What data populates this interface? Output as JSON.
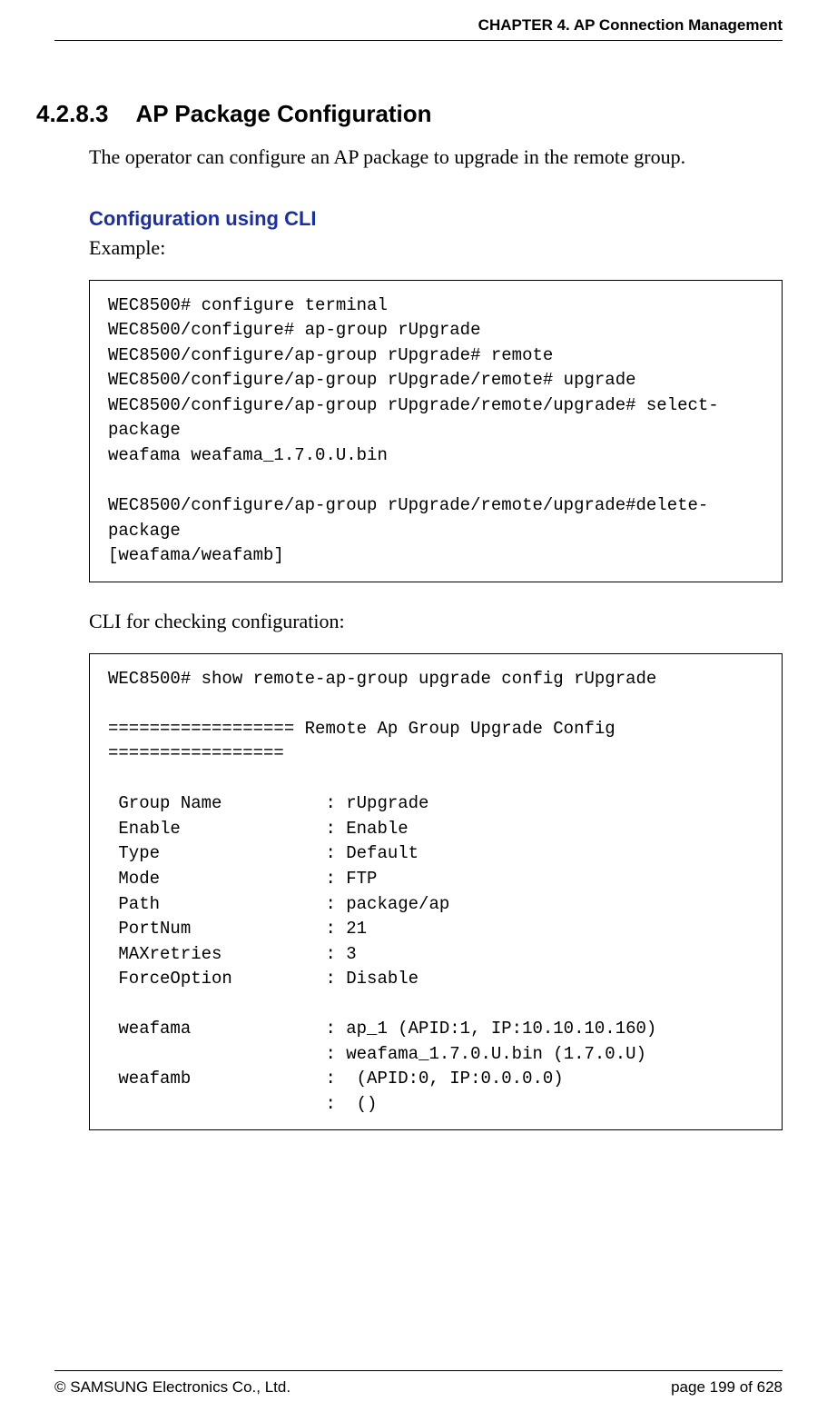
{
  "header": {
    "chapter": "CHAPTER 4. AP Connection Management"
  },
  "section": {
    "number": "4.2.8.3",
    "title": "AP Package Configuration",
    "intro": "The operator can configure an AP package to upgrade in the remote group."
  },
  "cli": {
    "heading": "Configuration using CLI",
    "example_label": "Example:",
    "code1": "WEC8500# configure terminal\nWEC8500/configure# ap-group rUpgrade\nWEC8500/configure/ap-group rUpgrade# remote\nWEC8500/configure/ap-group rUpgrade/remote# upgrade\nWEC8500/configure/ap-group rUpgrade/remote/upgrade# select-package\nweafama weafama_1.7.0.U.bin\n\nWEC8500/configure/ap-group rUpgrade/remote/upgrade#delete-package\n[weafama/weafamb]",
    "check_label": "CLI for checking configuration:",
    "code2": "WEC8500# show remote-ap-group upgrade config rUpgrade\n\n================== Remote Ap Group Upgrade Config =================\n\n Group Name          : rUpgrade\n Enable              : Enable\n Type                : Default\n Mode                : FTP\n Path                : package/ap\n PortNum             : 21\n MAXretries          : 3\n ForceOption         : Disable\n\n weafama             : ap_1 (APID:1, IP:10.10.10.160)\n                     : weafama_1.7.0.U.bin (1.7.0.U)\n weafamb             :  (APID:0, IP:0.0.0.0)\n                     :  ()"
  },
  "footer": {
    "copyright": "© SAMSUNG Electronics Co., Ltd.",
    "page": "page 199 of 628"
  }
}
